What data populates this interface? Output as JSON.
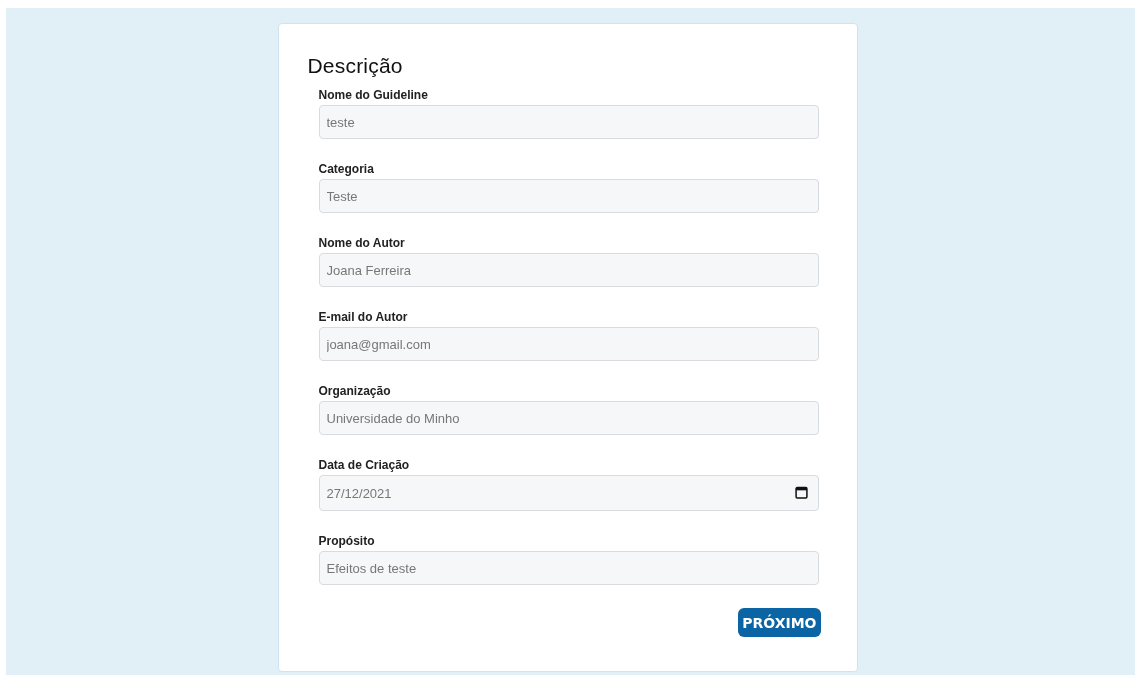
{
  "form": {
    "title": "Descrição",
    "fields": [
      {
        "label": "Nome do Guideline",
        "value": "teste",
        "kind": "text"
      },
      {
        "label": "Categoria",
        "value": "Teste",
        "kind": "text"
      },
      {
        "label": "Nome do Autor",
        "value": "Joana Ferreira",
        "kind": "text"
      },
      {
        "label": "E-mail do Autor",
        "value": "joana@gmail.com",
        "kind": "text"
      },
      {
        "label": "Organização",
        "value": "Universidade do Minho",
        "kind": "text"
      },
      {
        "label": "Data de Criação",
        "value": "27/12/2021",
        "kind": "date"
      },
      {
        "label": "Propósito",
        "value": "Efeitos de teste",
        "kind": "text"
      }
    ],
    "button": "PRÓXIMO"
  }
}
